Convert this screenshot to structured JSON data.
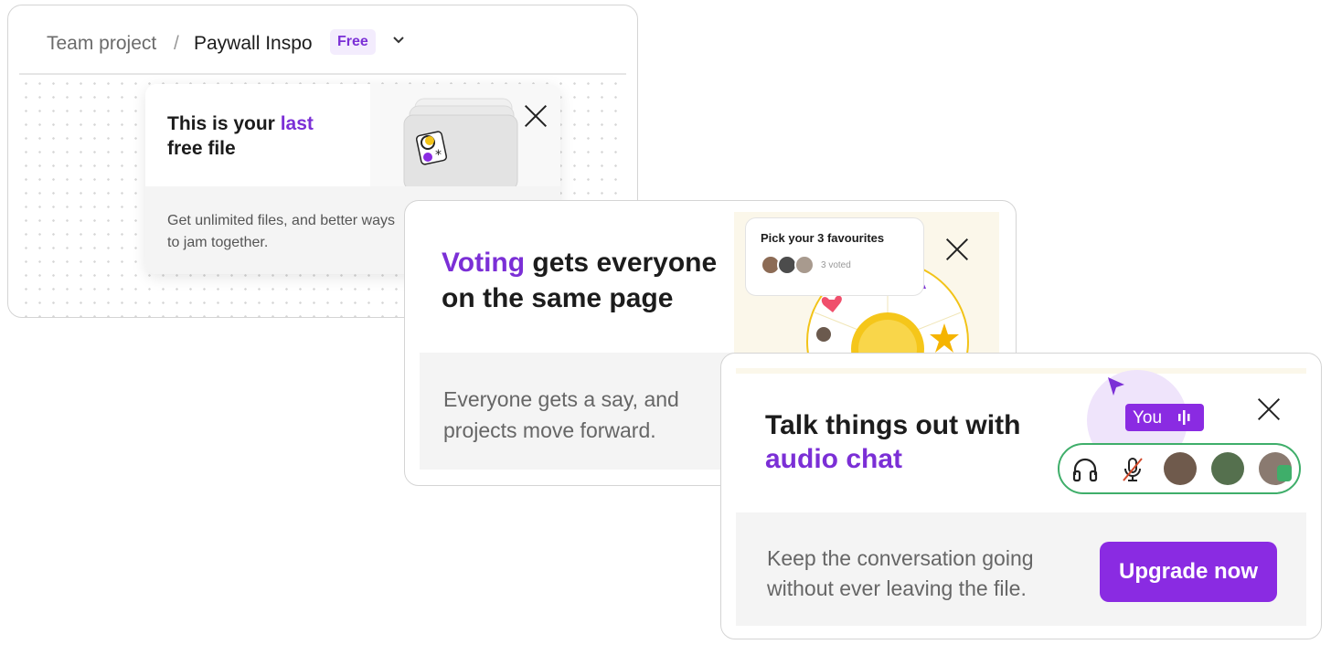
{
  "breadcrumb": {
    "team": "Team project",
    "separator": "/",
    "file": "Paywall Inspo",
    "badge": "Free"
  },
  "last_file_popover": {
    "title_part1": "This is your ",
    "title_highlight": "last",
    "title_part2": "free file",
    "body": "Get unlimited files, and better ways to jam together."
  },
  "voting_card": {
    "title_highlight": "Voting",
    "title_rest": " gets everyone on the same page",
    "body": "Everyone gets a say, and projects move forward.",
    "illustration": {
      "heading": "Pick your 3 favourites",
      "voted": "3 voted"
    }
  },
  "audio_card": {
    "title_part1": "Talk things out with",
    "title_highlight": "audio chat",
    "body": "Keep the conversation going without ever leaving the file.",
    "button": "Upgrade now",
    "you_tag": "You"
  },
  "colors": {
    "accent": "#8a2be2",
    "green_ring": "#3fae6a",
    "gold": "#f2c318"
  }
}
